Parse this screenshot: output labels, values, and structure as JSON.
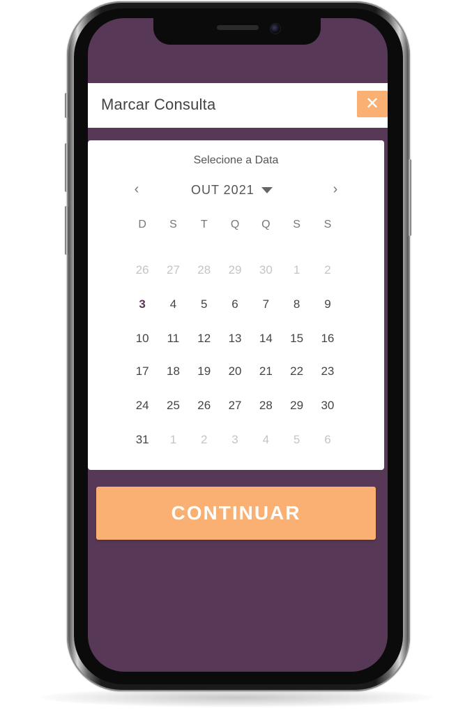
{
  "header": {
    "title": "Marcar Consulta",
    "close_glyph": "✕"
  },
  "calendar": {
    "title": "Selecione a Data",
    "month_label": "OUT 2021",
    "prev_glyph": "‹",
    "next_glyph": "›",
    "weekdays": [
      "D",
      "S",
      "T",
      "Q",
      "Q",
      "S",
      "S"
    ],
    "weeks": [
      [
        {
          "d": "26",
          "muted": true
        },
        {
          "d": "27",
          "muted": true
        },
        {
          "d": "28",
          "muted": true
        },
        {
          "d": "29",
          "muted": true
        },
        {
          "d": "30",
          "muted": true
        },
        {
          "d": "1",
          "muted": true
        },
        {
          "d": "2",
          "muted": true
        }
      ],
      [
        {
          "d": "3",
          "today": true
        },
        {
          "d": "4"
        },
        {
          "d": "5"
        },
        {
          "d": "6"
        },
        {
          "d": "7"
        },
        {
          "d": "8"
        },
        {
          "d": "9"
        }
      ],
      [
        {
          "d": "10"
        },
        {
          "d": "11"
        },
        {
          "d": "12"
        },
        {
          "d": "13"
        },
        {
          "d": "14"
        },
        {
          "d": "15"
        },
        {
          "d": "16"
        }
      ],
      [
        {
          "d": "17"
        },
        {
          "d": "18"
        },
        {
          "d": "19"
        },
        {
          "d": "20"
        },
        {
          "d": "21"
        },
        {
          "d": "22"
        },
        {
          "d": "23"
        }
      ],
      [
        {
          "d": "24"
        },
        {
          "d": "25"
        },
        {
          "d": "26"
        },
        {
          "d": "27"
        },
        {
          "d": "28"
        },
        {
          "d": "29"
        },
        {
          "d": "30"
        }
      ],
      [
        {
          "d": "31"
        },
        {
          "d": "1",
          "muted": true
        },
        {
          "d": "2",
          "muted": true
        },
        {
          "d": "3",
          "muted": true
        },
        {
          "d": "4",
          "muted": true
        },
        {
          "d": "5",
          "muted": true
        },
        {
          "d": "6",
          "muted": true
        }
      ]
    ]
  },
  "actions": {
    "continue_label": "CONTINUAR"
  },
  "colors": {
    "screen_bg": "#573856",
    "accent": "#f9b072"
  },
  "icons": {
    "close": "close-icon",
    "prev": "chevron-left-icon",
    "next": "chevron-right-icon",
    "caret": "caret-down-icon"
  }
}
